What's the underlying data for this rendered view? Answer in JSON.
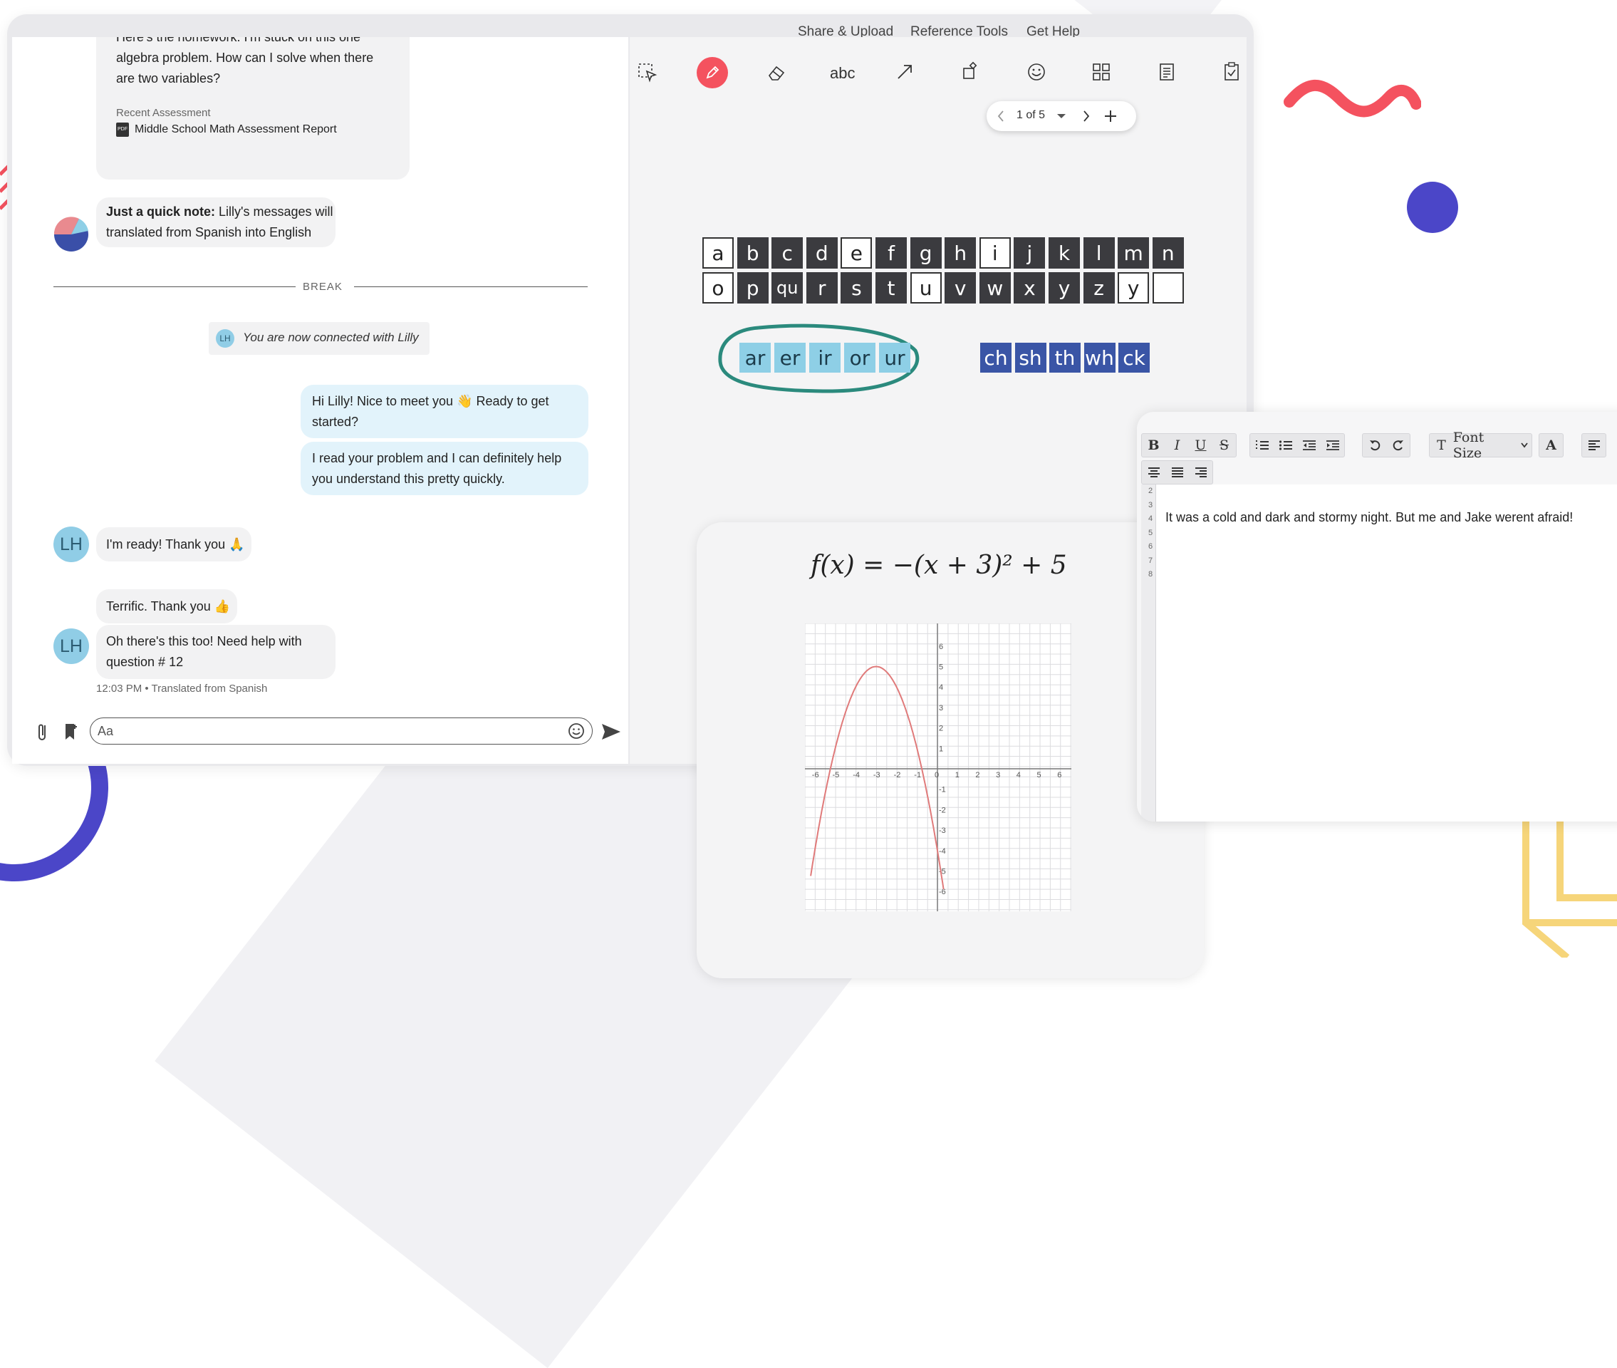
{
  "nav": {
    "share_upload": "Share & Upload",
    "reference_tools": "Reference Tools",
    "get_help": "Get Help"
  },
  "chat": {
    "homework_lines": [
      "Here's the homework. I'm stuck on this one",
      "algebra problem. How can I solve when there",
      "are two variables?"
    ],
    "recent_assessment_label": "Recent Assessment",
    "assessment_report": "Middle School Math Assessment Report",
    "pdf_badge": "PDF",
    "note_bold": "Just a quick note:",
    "note_rest_line1": " Lilly's messages will",
    "note_line2": "translated from Spanish into English",
    "break_label": "BREAK",
    "connected_avatar": "LH",
    "connected_text": "You are now connected with Lilly",
    "tutor_msg1_line1": "Hi Lilly! Nice to meet you 👋 Ready to get",
    "tutor_msg1_line2": "started?",
    "tutor_msg2_line1": "I read your problem and I can definitely help",
    "tutor_msg2_line2": "you understand this pretty quickly.",
    "student_avatar": "LH",
    "student_msg1": "I'm ready! Thank you 🙏",
    "tutor_msg3": "Terrific. Thank you 👍",
    "student_msg2_line1": "Oh there's this too! Need help with",
    "student_msg2_line2": "question # 12",
    "timestamp": "12:03 PM",
    "translated_note": "Translated from Spanish",
    "input_placeholder": "Aa"
  },
  "whiteboard": {
    "tools": [
      "select-icon",
      "pencil-icon",
      "eraser-icon",
      "text-tool-icon",
      "arrow-icon",
      "shapes-icon",
      "emoji-icon",
      "grid-icon",
      "document-icon",
      "clipboard-icon"
    ],
    "text_tool_label": "abc",
    "page_indicator": "1 of 5",
    "alphabet_row1": [
      "a",
      "b",
      "c",
      "d",
      "e",
      "f",
      "g",
      "h",
      "i",
      "j",
      "k",
      "l",
      "m",
      "n"
    ],
    "alphabet_row1_style": [
      "light",
      "dark",
      "dark",
      "dark",
      "light",
      "dark",
      "dark",
      "dark",
      "light",
      "dark",
      "dark",
      "dark",
      "dark",
      "dark"
    ],
    "alphabet_row2": [
      "o",
      "p",
      "qu",
      "r",
      "s",
      "t",
      "u",
      "v",
      "w",
      "x",
      "y",
      "z",
      "y",
      ""
    ],
    "alphabet_row2_style": [
      "light",
      "dark",
      "dark",
      "dark",
      "dark",
      "dark",
      "light",
      "dark",
      "dark",
      "dark",
      "dark",
      "dark",
      "light",
      "light"
    ],
    "vowel_blends": [
      "ar",
      "er",
      "ir",
      "or",
      "ur"
    ],
    "digraphs": [
      "ch",
      "sh",
      "th",
      "wh",
      "ck"
    ],
    "colors": {
      "pencil_active": "#f4525f",
      "circle_stroke": "#2b8a7d",
      "blend_light": "#8ecfe6",
      "blend_navy": "#3a55a6"
    }
  },
  "graph": {
    "equation": "f(x) = −(x + 3)² + 5",
    "x_ticks": [
      "-6",
      "-5",
      "-4",
      "-3",
      "-2",
      "-1",
      "0",
      "1",
      "2",
      "3",
      "4",
      "5",
      "6"
    ],
    "y_ticks": [
      "6",
      "5",
      "4",
      "3",
      "2",
      "1",
      "-1",
      "-2",
      "-3",
      "-4",
      "-5",
      "-6"
    ],
    "curve_color": "#e07a7a"
  },
  "editor": {
    "toolbar": {
      "bold": "B",
      "italic": "I",
      "underline": "U",
      "strike": "S",
      "font_size": "Font Size",
      "text_color": "A",
      "clear_format": "T"
    },
    "line_numbers": [
      "2",
      "3",
      "4",
      "5",
      "6",
      "7",
      "8"
    ],
    "text": "It was a cold and dark and stormy night. But me and Jake werent afraid!"
  }
}
